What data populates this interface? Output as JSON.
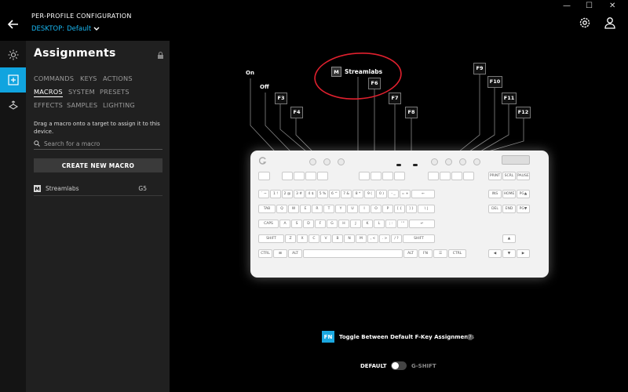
{
  "header": {
    "profile_title": "PER-PROFILE CONFIGURATION",
    "profile_prefix": "DESKTOP:",
    "profile_name": "Default",
    "window_controls": [
      "—",
      "☐",
      "✕"
    ]
  },
  "panel": {
    "title": "Assignments",
    "tabs_row1": [
      "COMMANDS",
      "KEYS",
      "ACTIONS"
    ],
    "tabs_row2": [
      "MACROS",
      "SYSTEM",
      "PRESETS"
    ],
    "tabs_row3": [
      "EFFECTS",
      "SAMPLES",
      "LIGHTING"
    ],
    "active_tab": "MACROS",
    "hint": "Drag a macro onto a target to assign it to this device.",
    "search_placeholder": "Search for a macro",
    "create_label": "CREATE NEW MACRO",
    "macros": [
      {
        "badge": "M",
        "name": "Streamlabs",
        "key": "G5"
      }
    ]
  },
  "keyboard": {
    "labels": {
      "on": "On",
      "off": "Off",
      "f3": "F3",
      "f4": "F4",
      "streamlabs_badge": "M",
      "streamlabs": "Streamlabs",
      "f6": "F6",
      "f7": "F7",
      "f8": "F8",
      "f9": "F9",
      "f10": "F10",
      "f11": "F11",
      "f12": "F12"
    },
    "keys": {
      "esc": "",
      "fn_row": [
        "",
        "",
        "",
        "",
        "",
        "",
        "",
        "",
        "",
        "",
        "",
        ""
      ],
      "nav_top": [
        "PRINT",
        "SCRL",
        "PAUSE"
      ],
      "num_row": [
        "` ~",
        "1 !",
        "2 @",
        "3 #",
        "4 $",
        "5 %",
        "6 ^",
        "7 &",
        "8 *",
        "9 (",
        "0 )",
        "- _",
        "= +",
        "←"
      ],
      "nav_row2": [
        "INS",
        "HOME",
        "PG▲"
      ],
      "q_row": [
        "TAB",
        "Q",
        "W",
        "E",
        "R",
        "T",
        "Y",
        "U",
        "I",
        "O",
        "P",
        "[ {",
        "] }",
        "\\ |"
      ],
      "nav_row3": [
        "DEL",
        "END",
        "PG▼"
      ],
      "a_row": [
        "CAPS",
        "A",
        "S",
        "D",
        "F",
        "G",
        "H",
        "J",
        "K",
        "L",
        "; :",
        "' \"",
        "↵"
      ],
      "z_row": [
        "SHIFT",
        "Z",
        "X",
        "C",
        "V",
        "B",
        "N",
        "M",
        ", <",
        ". >",
        "/ ?",
        "SHIFT"
      ],
      "bottom_row": [
        "CTRL",
        "⊞",
        "ALT",
        "",
        "ALT",
        "FN",
        "☰",
        "CTRL"
      ],
      "arrows": [
        "▲",
        "◀",
        "▼",
        "▶"
      ]
    }
  },
  "footer": {
    "fn_badge": "FN",
    "fn_text": "Toggle Between Default F-Key Assignments",
    "help": "?",
    "default_label": "DEFAULT",
    "gshift_label": "G-SHIFT"
  },
  "colors": {
    "accent": "#18b5ef",
    "annotation": "#e0202e"
  }
}
